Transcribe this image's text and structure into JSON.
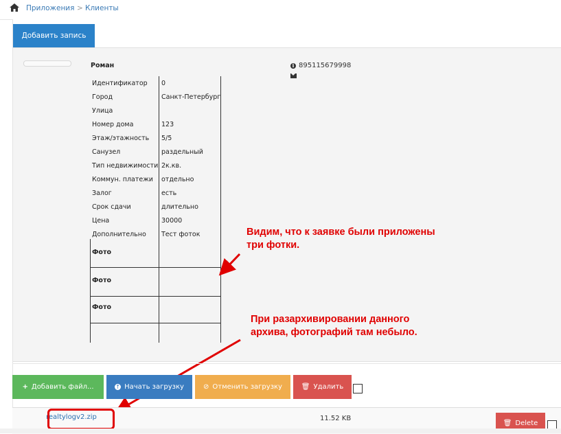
{
  "breadcrumb": {
    "item1": "Приложения",
    "separator": ">",
    "item2": "Клиенты"
  },
  "toolbar": {
    "add_record": "Добавить запись"
  },
  "client": {
    "name": "Роман",
    "phone": "895115679998",
    "fields": [
      {
        "label": "Идентификатор",
        "value": "0"
      },
      {
        "label": "Город",
        "value": "Санкт-Петербург"
      },
      {
        "label": "Улица",
        "value": ""
      },
      {
        "label": "Номер дома",
        "value": "123"
      },
      {
        "label": "Этаж/этажность",
        "value": "5/5"
      },
      {
        "label": "Санузел",
        "value": "раздельный"
      },
      {
        "label": "Тип недвижимости",
        "value": "2к.кв."
      },
      {
        "label": "Коммун. платежи",
        "value": "отдельно"
      },
      {
        "label": "Залог",
        "value": "есть"
      },
      {
        "label": "Срок сдачи",
        "value": "длительно"
      },
      {
        "label": "Цена",
        "value": "30000"
      },
      {
        "label": "Дополнительно",
        "value": "Тест фоток"
      }
    ],
    "photo_label": "Фото"
  },
  "annotations": {
    "note1_line1": "Видим, что к заявке были приложены",
    "note1_line2": "три фотки.",
    "note2_line1": "При разархивировании данного",
    "note2_line2": "архива, фотографий там небыло."
  },
  "upload": {
    "add_files": "Добавить файл...",
    "start_upload": "Начать загрузку",
    "cancel_upload": "Отменить загрузку",
    "delete": "Удалить"
  },
  "file": {
    "name": "realtylogv2.zip",
    "size": "11.52 KB",
    "delete": "Delete"
  },
  "colors": {
    "primary": "#2b82c9",
    "success": "#5cb85c",
    "warning": "#f0ad4e",
    "danger": "#d9534f",
    "annotation": "#e00000"
  }
}
